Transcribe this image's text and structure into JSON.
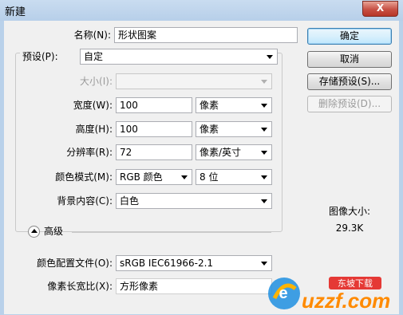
{
  "window": {
    "title": "新建",
    "close_glyph": "X"
  },
  "name": {
    "label": "名称(N):",
    "value": "形状图案"
  },
  "preset": {
    "label": "预设(P):",
    "value": "自定"
  },
  "size": {
    "label": "大小(I):",
    "value": ""
  },
  "width": {
    "label": "宽度(W):",
    "value": "100",
    "unit": "像素"
  },
  "height": {
    "label": "高度(H):",
    "value": "100",
    "unit": "像素"
  },
  "resolution": {
    "label": "分辨率(R):",
    "value": "72",
    "unit": "像素/英寸"
  },
  "color_mode": {
    "label": "颜色模式(M):",
    "value": "RGB 颜色",
    "depth": "8 位"
  },
  "background": {
    "label": "背景内容(C):",
    "value": "白色"
  },
  "advanced": {
    "label": "高级",
    "color_profile": {
      "label": "颜色配置文件(O):",
      "value": "sRGB IEC61966-2.1"
    },
    "pixel_aspect": {
      "label": "像素长宽比(X):",
      "value": "方形像素"
    }
  },
  "buttons": {
    "ok": "确定",
    "cancel": "取消",
    "save_preset": "存储预设(S)...",
    "delete_preset": "删除预设(D)..."
  },
  "image_size": {
    "label": "图像大小:",
    "value": "29.3K"
  },
  "watermark": {
    "brand": "uzzf.com",
    "tag": "东坡下载"
  },
  "colors": {
    "window_frame": "#b9d1ea",
    "client_bg": "#f0f0f0",
    "close_red": "#c75044"
  },
  "icons": [
    "close-icon",
    "dropdown-arrow-icon",
    "collapse-chevron-icon"
  ]
}
